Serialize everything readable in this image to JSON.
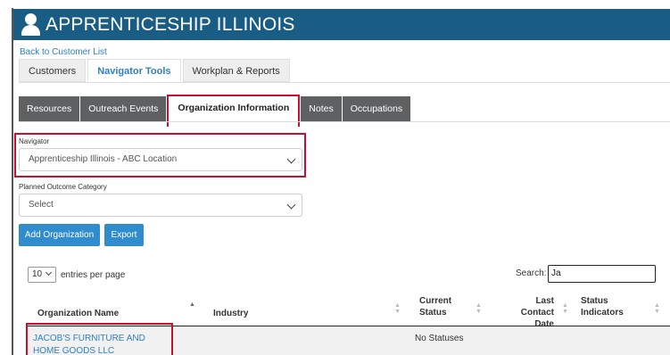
{
  "header": {
    "title": "APPRENTICESHIP ILLINOIS",
    "icon": "user-icon"
  },
  "back_link": "Back to Customer List",
  "main_tabs": [
    {
      "label": "Customers",
      "active": false
    },
    {
      "label": "Navigator Tools",
      "active": true
    },
    {
      "label": "Workplan & Reports",
      "active": false
    }
  ],
  "sub_tabs": [
    {
      "label": "Resources",
      "active": false
    },
    {
      "label": "Outreach Events",
      "active": false
    },
    {
      "label": "Organization Information",
      "active": true
    },
    {
      "label": "Notes",
      "active": false
    },
    {
      "label": "Occupations",
      "active": false
    }
  ],
  "form": {
    "navigator": {
      "label": "Navigator",
      "value": "Apprenticeship Illinois - ABC Location"
    },
    "planned_outcome": {
      "label": "Planned Outcome Category",
      "value": "Select"
    }
  },
  "buttons": {
    "add_organization": "Add Organization",
    "export": "Export"
  },
  "table_controls": {
    "entries_value": "10",
    "entries_suffix": "entries per page",
    "search_label": "Search:",
    "search_value": "Ja"
  },
  "table": {
    "columns": {
      "org_name": "Organization Name",
      "industry": "Industry",
      "current_status_1": "Current",
      "current_status_2": "Status",
      "last_contact_1": "Last Contact",
      "last_contact_2": "Date",
      "status_ind_1": "Status",
      "status_ind_2": "Indicators"
    },
    "rows": [
      {
        "org_name": "JACOB'S FURNITURE AND HOME GOODS LLC",
        "industry": "",
        "current_status": "No Statuses",
        "last_contact": "",
        "status_indicators": ""
      }
    ]
  },
  "colors": {
    "header_bg": "#1a5d84",
    "accent": "#2f8ccd",
    "highlight": "#c8102e",
    "sub_tab_bg": "#5f6062"
  }
}
